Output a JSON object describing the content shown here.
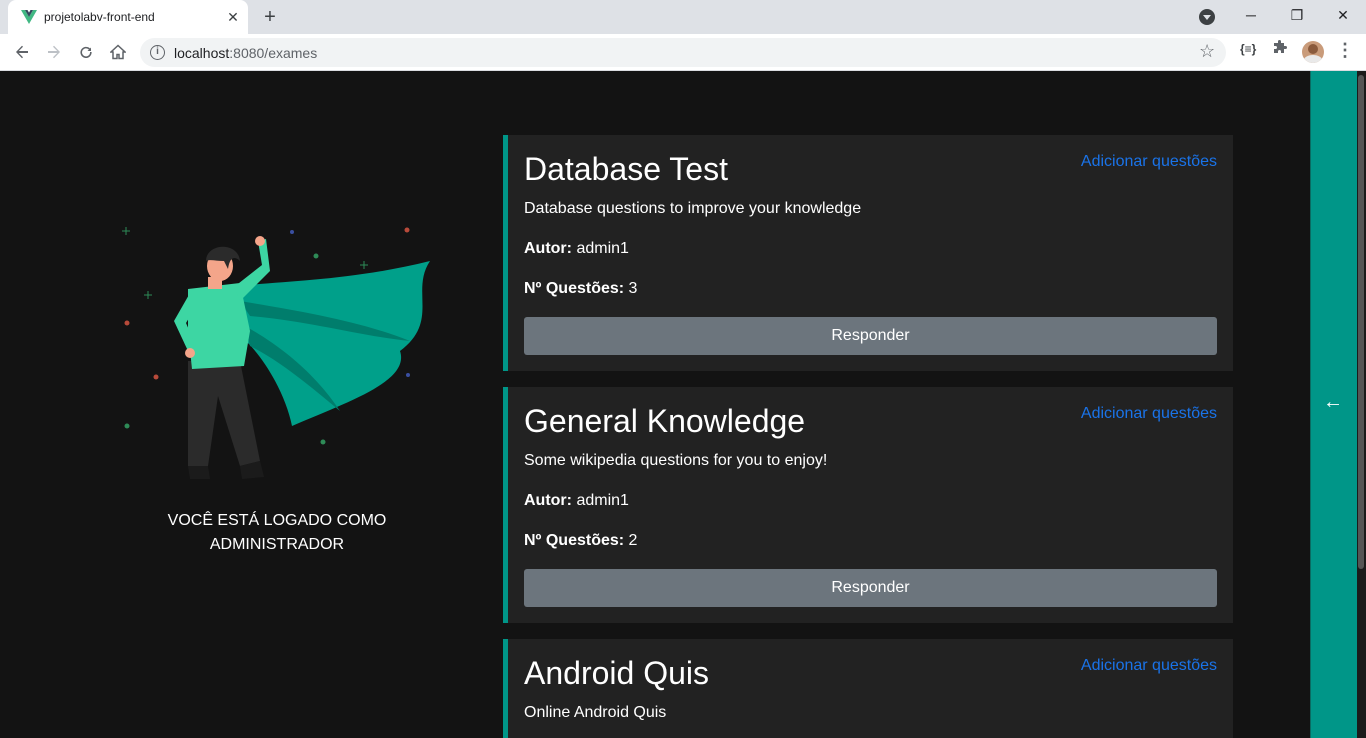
{
  "browser": {
    "tab_title": "projetolabv-front-end",
    "tab_close": "✕",
    "new_tab": "+",
    "url_host": "localhost",
    "url_rest": ":8080/exames",
    "ext_label": "{≡}",
    "win_minimize": "─",
    "win_restore": "❐",
    "win_close": "✕"
  },
  "sidebar_toggle": {
    "arrow": "←"
  },
  "hero": {
    "caption": "VOCÊ ESTÁ LOGADO COMO ADMINISTRADOR"
  },
  "labels": {
    "author": "Autor:",
    "count": "Nº Questões:"
  },
  "exams": [
    {
      "title": "Database Test",
      "add_label": "Adicionar questões",
      "description": "Database questions to improve your knowledge",
      "author": "admin1",
      "count": "3",
      "button": "Responder"
    },
    {
      "title": "General Knowledge",
      "add_label": "Adicionar questões",
      "description": "Some wikipedia questions for you to enjoy!",
      "author": "admin1",
      "count": "2",
      "button": "Responder"
    },
    {
      "title": "Android Quis",
      "add_label": "Adicionar questões",
      "description": "Online Android Quis"
    }
  ],
  "colors": {
    "accent": "#009688",
    "link": "#1a73e8",
    "card_bg": "#222222",
    "page_bg": "#131313",
    "button_bg": "#6c757d"
  }
}
